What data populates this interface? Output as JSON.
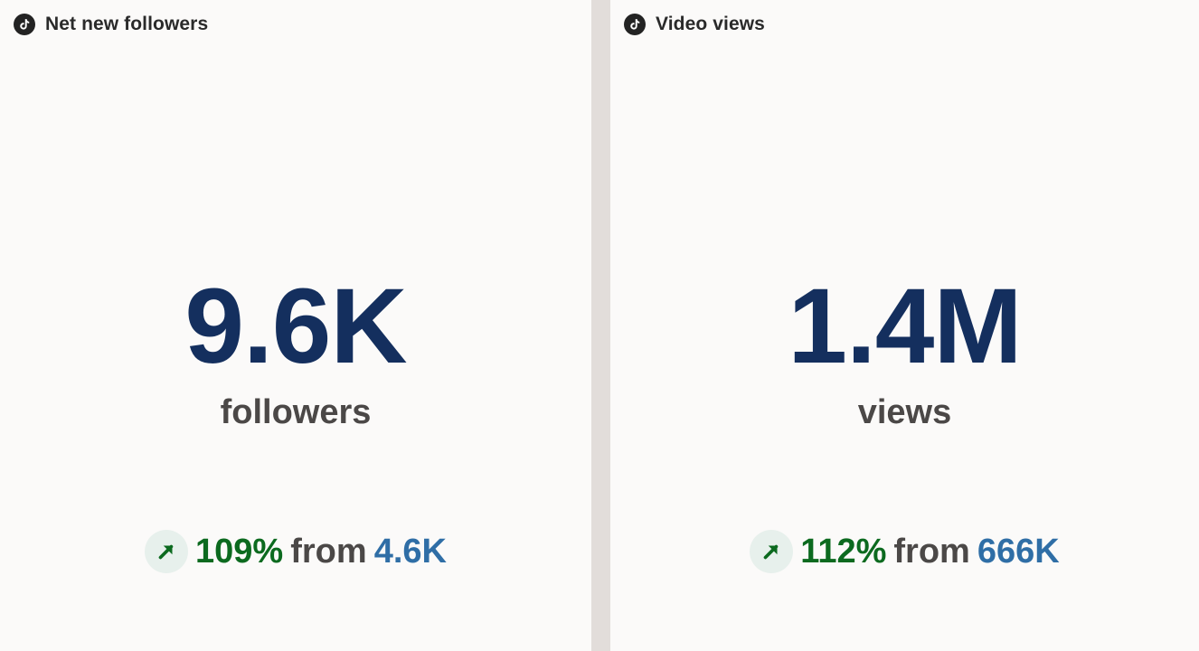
{
  "colors": {
    "background_divider": "#e2ddda",
    "panel_bg": "#fbfaf9",
    "metric": "#142f5e",
    "unit": "#4b4847",
    "positive": "#0c6a1f",
    "positive_badge_bg": "#e7f0ec",
    "previous": "#2f6ea6",
    "icon_bg": "#232323"
  },
  "cards": [
    {
      "icon": "tiktok-icon",
      "title": "Net new followers",
      "value": "9.6K",
      "unit": "followers",
      "change": {
        "direction_icon": "arrow-up-right-icon",
        "percent": "109%",
        "from_label": "from",
        "previous": "4.6K"
      }
    },
    {
      "icon": "tiktok-icon",
      "title": "Video views",
      "value": "1.4M",
      "unit": "views",
      "change": {
        "direction_icon": "arrow-up-right-icon",
        "percent": "112%",
        "from_label": "from",
        "previous": "666K"
      }
    }
  ]
}
